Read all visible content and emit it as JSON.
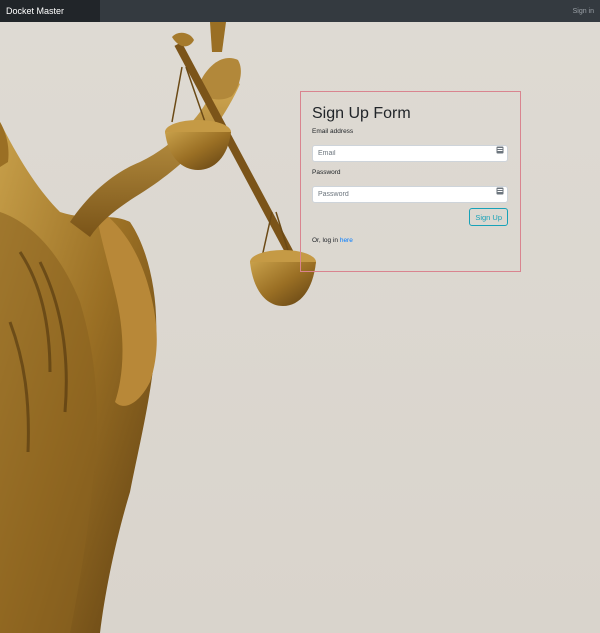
{
  "navbar": {
    "brand": "Docket Master",
    "sign_in": "Sign in"
  },
  "form": {
    "title": "Sign Up Form",
    "email_label": "Email address",
    "email_placeholder": "Email",
    "email_value": "",
    "password_label": "Password",
    "password_placeholder": "Password",
    "password_value": "",
    "submit_label": "Sign Up",
    "login_prefix": "Or, log in ",
    "login_link": "here"
  },
  "colors": {
    "navbar_bg": "#343a40",
    "brand_bg": "#212529",
    "card_border": "#d9848f",
    "button_accent": "#17a2b8",
    "link": "#007bff"
  },
  "icons": {
    "input_icon": "password-manager-key-icon"
  }
}
